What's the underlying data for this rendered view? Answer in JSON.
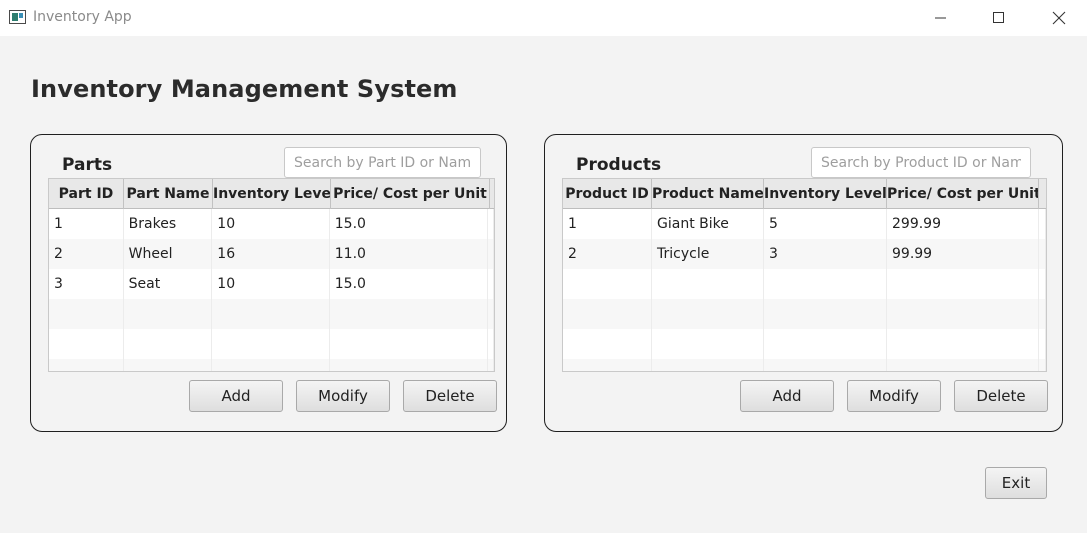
{
  "window": {
    "title": "Inventory App",
    "icon": "app-icon",
    "controls": [
      "minimize-icon",
      "maximize-icon",
      "close-icon"
    ]
  },
  "page": {
    "title": "Inventory Management System"
  },
  "parts": {
    "label": "Parts",
    "search_placeholder": "Search by Part ID or Name",
    "columns": [
      "Part ID",
      "Part Name",
      "Inventory Level",
      "Price/ Cost per Unit"
    ],
    "rows": [
      [
        "1",
        "Brakes",
        "10",
        "15.0"
      ],
      [
        "2",
        "Wheel",
        "16",
        "11.0"
      ],
      [
        "3",
        "Seat",
        "10",
        "15.0"
      ]
    ],
    "buttons": {
      "add": "Add",
      "modify": "Modify",
      "delete": "Delete"
    }
  },
  "products": {
    "label": "Products",
    "search_placeholder": "Search by Product ID or Name",
    "columns": [
      "Product ID",
      "Product Name",
      "Inventory Level",
      "Price/ Cost per Unit"
    ],
    "rows": [
      [
        "1",
        "Giant Bike",
        "5",
        "299.99"
      ],
      [
        "2",
        "Tricycle",
        "3",
        "99.99"
      ]
    ],
    "buttons": {
      "add": "Add",
      "modify": "Modify",
      "delete": "Delete"
    }
  },
  "footer": {
    "exit_label": "Exit"
  }
}
